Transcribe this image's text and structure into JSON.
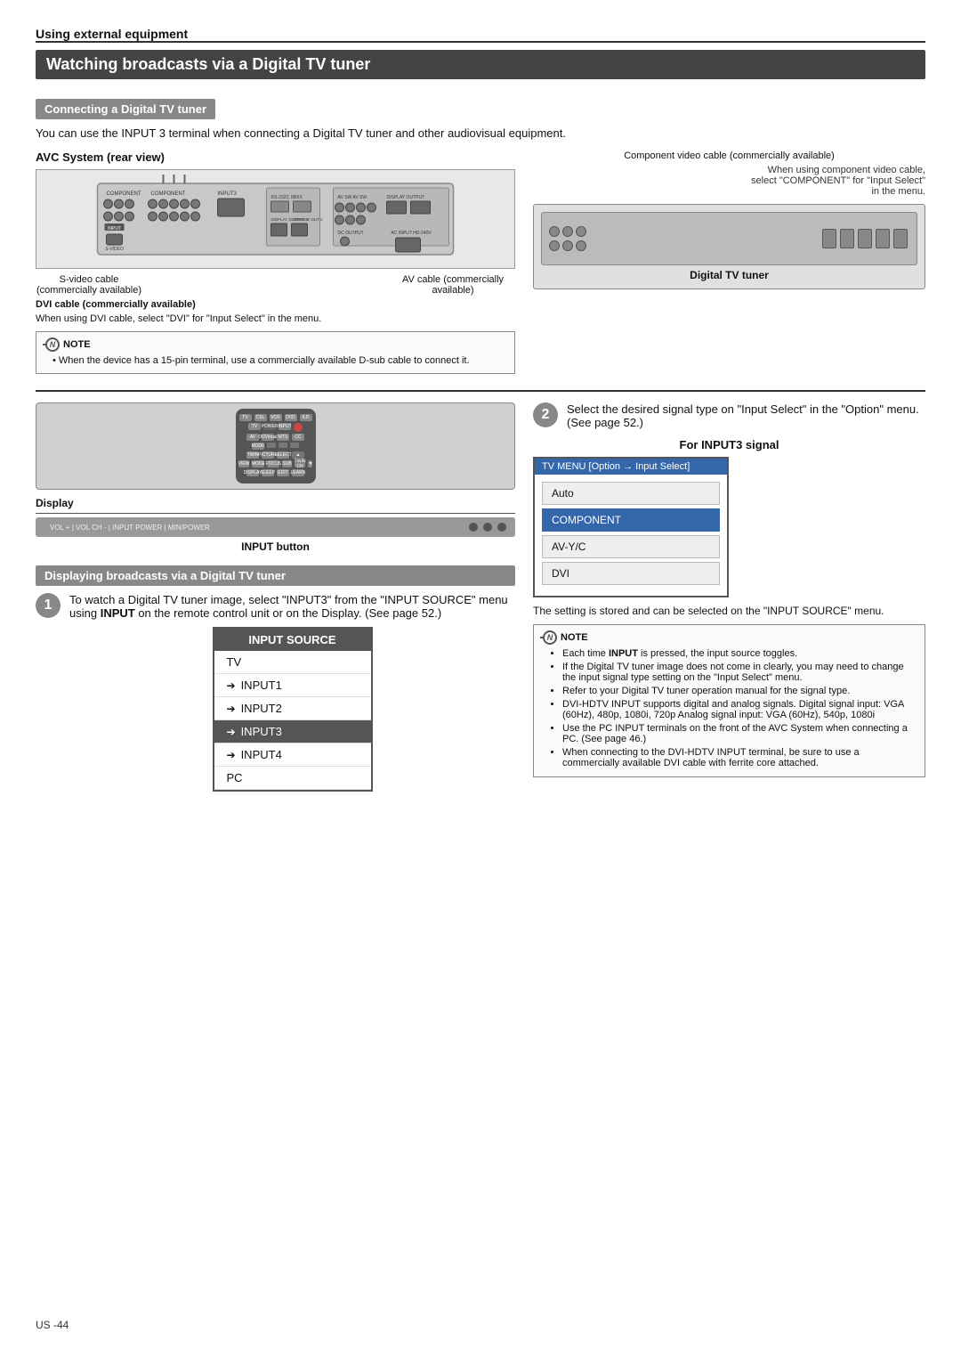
{
  "page": {
    "section_title": "Using external equipment",
    "main_heading": "Watching broadcasts via a Digital TV tuner",
    "sub_heading_1": "Connecting a Digital TV tuner",
    "intro_text": "You can use the INPUT 3 terminal when connecting a Digital TV tuner and other audiovisual equipment.",
    "avc_label": "AVC System (rear view)",
    "component_cable_label": "Component video cable\n(commercially available)",
    "right_note": "When using component video cable, select \"COMPONENT\" for \"Input Select\" in the menu.",
    "svideo_label": "S-video cable\n(commercially available)",
    "av_cable_label": "AV cable\n(commercially available)",
    "dvi_cable_label": "DVI cable (commercially available)",
    "dvi_note": "When using DVI cable, select \"DVI\" for\n\"Input Select\" in the menu.",
    "note_header": "NOTE",
    "note_item": "When the device has a 15-pin terminal, use a commercially available D-sub cable to connect it.",
    "digital_tv_label": "Digital TV tuner",
    "display_label": "Display",
    "input_btn_label": "INPUT button",
    "sub_heading_2": "Displaying broadcasts via a Digital TV tuner",
    "step1_text": "To watch a Digital TV tuner image, select \"INPUT3\" from the \"INPUT SOURCE\" menu using INPUT on the remote control unit or on the Display. (See page 52.)",
    "input_source_header": "INPUT SOURCE",
    "input_source_items": [
      {
        "label": "TV",
        "arrow": false,
        "active": false
      },
      {
        "label": "INPUT1",
        "arrow": true,
        "active": false
      },
      {
        "label": "INPUT2",
        "arrow": true,
        "active": false
      },
      {
        "label": "INPUT3",
        "arrow": true,
        "active": true
      },
      {
        "label": "INPUT4",
        "arrow": true,
        "active": false
      },
      {
        "label": "PC",
        "arrow": false,
        "active": false
      }
    ],
    "step2_text": "Select the desired signal type on \"Input Select\" in the \"Option\" menu. (See page 52.)",
    "for_input3_label": "For INPUT3 signal",
    "tv_menu_header": "TV MENU  [Option → Input Select]",
    "tv_menu_items": [
      {
        "label": "Auto",
        "selected": false
      },
      {
        "label": "COMPONENT",
        "selected": true
      },
      {
        "label": "AV-Y/C",
        "selected": false
      },
      {
        "label": "DVI",
        "selected": false
      }
    ],
    "store_text": "The setting is stored and can be selected on the \"INPUT SOURCE\" menu.",
    "note2_header": "NOTE",
    "note2_items": [
      "Each time INPUT is pressed, the input source toggles.",
      "If the Digital TV tuner image does not come in clearly, you may need to change the input signal type setting on the \"Input Select\" menu.",
      "Refer to your Digital TV tuner operation manual for the signal type.",
      "DVI-HDTV INPUT supports digital and analog signals. Digital signal input: VGA (60Hz), 480p, 1080i, 720p  Analog signal input: VGA (60Hz), 540p, 1080i",
      "Use the PC INPUT terminals on the front of the AVC System when connecting a PC. (See page 46.)",
      "When connecting to the DVI-HDTV INPUT terminal, be sure to use a commercially available DVI cable with ferrite core attached."
    ],
    "page_num": "US -44"
  }
}
